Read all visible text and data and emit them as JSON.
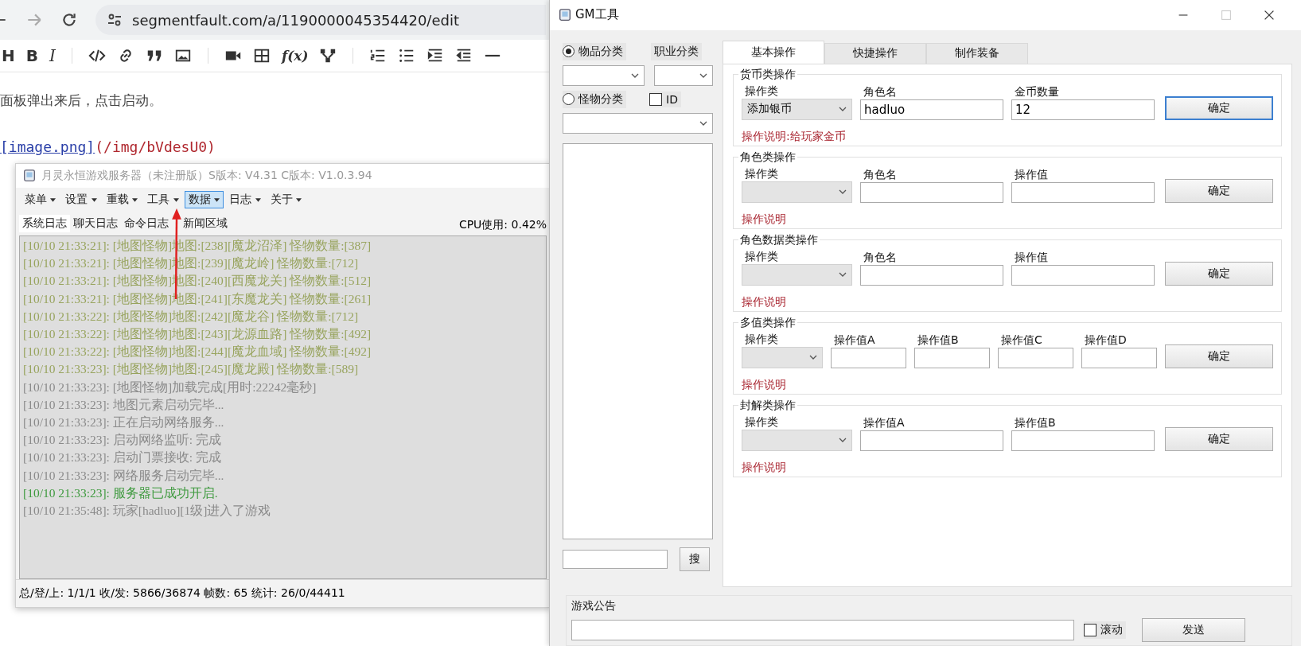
{
  "browser": {
    "address": "segmentfault.com/a/1190000045354420/edit",
    "format_buttons": [
      "H",
      "B",
      "I"
    ],
    "formula_button": "f(x)"
  },
  "editor": {
    "paragraph": "面板弹出来后，点击启动。",
    "link_label": "[image.png]",
    "link_url": "(/img/bVdesU0)"
  },
  "server": {
    "title": "月灵永恒游戏服务器（未注册版）S版本: V4.31 C版本: V1.0.3.94",
    "menu": [
      {
        "label": "菜单",
        "selected": false
      },
      {
        "label": "设置",
        "selected": false
      },
      {
        "label": "重载",
        "selected": false
      },
      {
        "label": "工具",
        "selected": false
      },
      {
        "label": "数据",
        "selected": true
      },
      {
        "label": "日志",
        "selected": false
      },
      {
        "label": "关于",
        "selected": false
      }
    ],
    "tabs": [
      {
        "label": "系统日志",
        "selected": true
      },
      {
        "label": "聊天日志",
        "selected": false
      },
      {
        "label": "命令日志",
        "selected": false
      },
      {
        "label": "新闻区域",
        "selected": false
      }
    ],
    "cpu": "CPU使用: 0.42%",
    "log": [
      {
        "text": "[10/10 21:33:21]: [地图怪物]地图:[238][魔龙沼泽] 怪物数量:[387]",
        "color": "#98a45e"
      },
      {
        "text": "[10/10 21:33:21]: [地图怪物]地图:[239][魔龙岭] 怪物数量:[712]",
        "color": "#98a45e"
      },
      {
        "text": "[10/10 21:33:21]: [地图怪物]地图:[240][西魔龙关] 怪物数量:[512]",
        "color": "#98a45e"
      },
      {
        "text": "[10/10 21:33:21]: [地图怪物]地图:[241][东魔龙关] 怪物数量:[261]",
        "color": "#98a45e"
      },
      {
        "text": "[10/10 21:33:22]: [地图怪物]地图:[242][魔龙谷] 怪物数量:[712]",
        "color": "#98a45e"
      },
      {
        "text": "[10/10 21:33:22]: [地图怪物]地图:[243][龙源血路] 怪物数量:[492]",
        "color": "#98a45e"
      },
      {
        "text": "[10/10 21:33:22]: [地图怪物]地图:[244][魔龙血域] 怪物数量:[492]",
        "color": "#98a45e"
      },
      {
        "text": "[10/10 21:33:23]: [地图怪物]地图:[245][魔龙殿] 怪物数量:[589]",
        "color": "#98a45e"
      },
      {
        "text": "[10/10 21:33:23]: [地图怪物]加载完成[用时:22242毫秒]",
        "color": "#8a8a8a"
      },
      {
        "text": "[10/10 21:33:23]: 地图元素启动完毕...",
        "color": "#8a8a8a"
      },
      {
        "text": "[10/10 21:33:23]: 正在启动网络服务...",
        "color": "#8a8a8a"
      },
      {
        "text": "[10/10 21:33:23]: 启动网络监听: 完成",
        "color": "#8a8a8a"
      },
      {
        "text": "[10/10 21:33:23]: 启动门票接收: 完成",
        "color": "#8a8a8a"
      },
      {
        "text": "[10/10 21:33:23]: 网络服务启动完毕...",
        "color": "#8a8a8a"
      },
      {
        "text": "[10/10 21:33:23]: 服务器已成功开启.",
        "color": "#3f9a3f"
      },
      {
        "text": "[10/10 21:35:48]: 玩家[hadluo][1级]进入了游戏",
        "color": "#8a8a8a"
      }
    ],
    "status": "总/登/上: 1/1/1  收/发: 5866/36874  帧数: 65  统计: 26/0/44411"
  },
  "gm": {
    "title": "GM工具",
    "item_category": {
      "label": "物品分类",
      "selected": true
    },
    "job_category": "职业分类",
    "monster_category": {
      "label": "怪物分类",
      "selected": false
    },
    "id_checkbox": {
      "label": "ID",
      "checked": false
    },
    "search_button": "搜",
    "tabs": [
      {
        "label": "基本操作",
        "selected": true
      },
      {
        "label": "快捷操作",
        "selected": false
      },
      {
        "label": "制作装备",
        "selected": false
      }
    ],
    "groups": [
      {
        "title": "货币类操作",
        "fields": [
          {
            "label": "操作类",
            "kind": "select",
            "value": "添加银币"
          },
          {
            "label": "角色名",
            "kind": "input",
            "value": "hadluo"
          },
          {
            "label": "金币数量",
            "kind": "input",
            "value": "12"
          }
        ],
        "button": "确定",
        "focused": true,
        "note": "操作说明:给玩家金币"
      },
      {
        "title": "角色类操作",
        "fields": [
          {
            "label": "操作类",
            "kind": "select"
          },
          {
            "label": "角色名",
            "kind": "input"
          },
          {
            "label": "操作值",
            "kind": "input"
          }
        ],
        "button": "确定",
        "focused": false,
        "note": "操作说明"
      },
      {
        "title": "角色数据类操作",
        "fields": [
          {
            "label": "操作类",
            "kind": "select"
          },
          {
            "label": "角色名",
            "kind": "input"
          },
          {
            "label": "操作值",
            "kind": "input"
          }
        ],
        "button": "确定",
        "focused": false,
        "note": "操作说明"
      },
      {
        "title": "多值类操作",
        "fields": [
          {
            "label": "操作类",
            "kind": "select"
          },
          {
            "label": "操作值A",
            "kind": "input"
          },
          {
            "label": "操作值B",
            "kind": "input"
          },
          {
            "label": "操作值C",
            "kind": "input"
          },
          {
            "label": "操作值D",
            "kind": "input"
          }
        ],
        "button": "确定",
        "focused": false,
        "note": "操作说明"
      },
      {
        "title": "封解类操作",
        "fields": [
          {
            "label": "操作类",
            "kind": "select"
          },
          {
            "label": "操作值A",
            "kind": "input"
          },
          {
            "label": "操作值B",
            "kind": "input"
          }
        ],
        "button": "确定",
        "focused": false,
        "note": "操作说明"
      }
    ],
    "announcement_label": "游戏公告",
    "scroll_checkbox": {
      "label": "滚动",
      "checked": false
    },
    "send_button": "发送"
  }
}
